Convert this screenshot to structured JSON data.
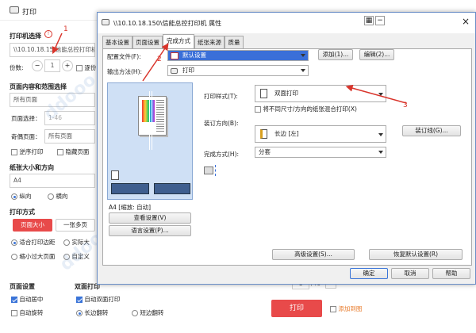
{
  "bg": {
    "title": "打印",
    "printer_section": "打印机选择",
    "printer_badge": "1",
    "printer_value": "\\\\10.10.18.15\\信能总控打印机",
    "copies_label": "份数:",
    "copies_value": "1",
    "collate_label": "逐份",
    "range_section": "页面内容和范围选择",
    "range_value": "所有页面",
    "page_select_label": "页面选择：",
    "page_select_placeholder": "1-46",
    "odd_even_label": "奇偶页面：",
    "odd_even_value": "所有页面",
    "reverse_label": "逆序打印",
    "hide_label": "隐藏页面",
    "paper_section": "纸张大小和方向",
    "paper_value": "A4",
    "portrait": "纵向",
    "landscape": "横向",
    "print_mode_section": "打印方式",
    "mode_btn_page_size": "页面大小",
    "mode_btn_one_per": "一张多页",
    "fit_label": "适合打印边距",
    "actual_label": "实际大",
    "shrink_label": "缩小过大页面",
    "custom_label": "自定义",
    "page_setup_section": "页面设置",
    "center_label": "自动居中",
    "rotate_label": "自动旋转",
    "duplex_section": "双面打印",
    "auto_duplex_label": "自动双面打印",
    "long_edge_label": "长边翻转",
    "short_edge_label": "短边翻转",
    "page_num_value": "1",
    "page_total": "/46",
    "print_btn": "打印",
    "share_label": "添加到图"
  },
  "prop": {
    "title": "\\\\10.10.18.150\\信能总控打印机 属性",
    "tabs": [
      "基本设置",
      "页面设置",
      "完成方式",
      "纸张来源",
      "质量"
    ],
    "config_label": "配置文件(F):",
    "config_value": "默认设置",
    "add_btn": "添加(1)...",
    "edit_btn": "编辑(2)...",
    "output_label": "输出方法(H):",
    "output_value": "打印",
    "print_style_label": "打印样式(T):",
    "print_style_value": "双面打印",
    "mixed_label": "将不同尺寸/方向的纸张混合打印(X)",
    "binding_dir_label": "装订方向(B):",
    "binding_dir_value": "长边 [左]",
    "binding_btn": "装订线(G)...",
    "finish_label": "完成方式(H):",
    "finish_value": "分套",
    "preview_caption": "A4 [缩放: 自动]",
    "view_settings_btn": "查看设置(V)",
    "lang_settings_btn": "语言设置(P)...",
    "advanced_btn": "高级设置(S)...",
    "restore_btn": "恢复默认设置(R)",
    "ok_btn": "确定",
    "cancel_btn": "取消",
    "help_btn": "帮助"
  },
  "annotations": [
    "1",
    "2",
    "3"
  ],
  "colors": {
    "accent": "#3a74d8",
    "print_red": "#e84a4a",
    "arrow": "#d9342b"
  }
}
